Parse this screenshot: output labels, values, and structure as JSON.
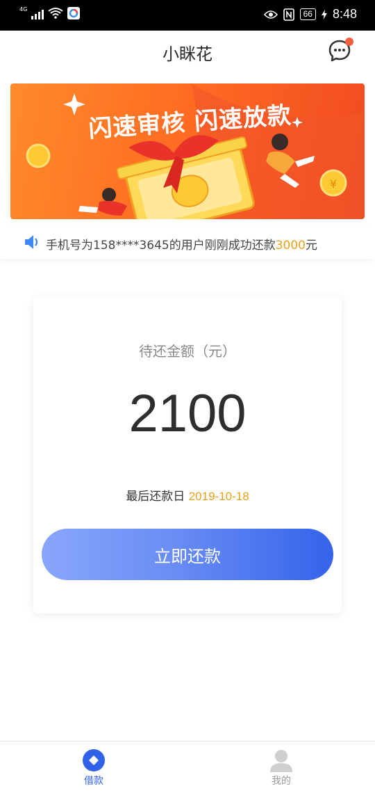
{
  "status_bar": {
    "network": "4G",
    "battery": "66",
    "time": "8:48"
  },
  "header": {
    "title": "小眯花",
    "message_icon": "chat-bubble-icon"
  },
  "banner": {
    "title": "闪速审核 闪速放款"
  },
  "notice": {
    "icon": "speaker-icon",
    "text_prefix": "手机号为158****3645的用户刚刚成功还款",
    "amount": "3000",
    "text_suffix": "元"
  },
  "card": {
    "label": "待还金额（元）",
    "amount": "2100",
    "due_label": "最后还款日 ",
    "due_date": "2019-10-18",
    "button_label": "立即还款"
  },
  "tabs": [
    {
      "label": "借款",
      "icon": "diamond-circle-icon",
      "active": true
    },
    {
      "label": "我的",
      "icon": "person-icon",
      "active": false
    }
  ],
  "colors": {
    "accent_blue": "#2f62e8",
    "highlight_orange": "#e8a21a",
    "badge_red": "#f06040"
  }
}
